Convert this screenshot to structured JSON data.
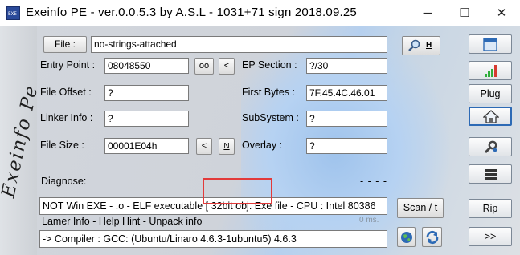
{
  "window": {
    "title": "Exeinfo PE - ver.0.0.5.3  by A.S.L  -  1031+71 sign  2018.09.25",
    "icon_label": "EXE",
    "minimize_glyph": "─",
    "maximize_glyph": "☐",
    "close_glyph": "✕"
  },
  "sidebar": {
    "brand": "Exeinfo Pe"
  },
  "file": {
    "button_label": "File :",
    "value": "no-strings-attached",
    "search_hotkey": "H"
  },
  "fields": {
    "entry_point": {
      "label": "Entry Point :",
      "value": "08048550"
    },
    "ep_section": {
      "label": "EP Section :",
      "value": "?/30"
    },
    "file_offset": {
      "label": "File Offset :",
      "value": "?"
    },
    "first_bytes": {
      "label": "First Bytes :",
      "value": "7F.45.4C.46.01"
    },
    "linker_info": {
      "label": "Linker Info :",
      "value": "?"
    },
    "subsystem": {
      "label": "SubSystem :",
      "value": "?"
    },
    "file_size": {
      "label": "File Size :",
      "value": "00001E04h"
    },
    "overlay": {
      "label": "Overlay :",
      "value": "?"
    }
  },
  "entry_buttons": {
    "oo": "oo",
    "lt": "<"
  },
  "size_buttons": {
    "lt": "<",
    "n": "N"
  },
  "diagnose": {
    "label": "Diagnose:",
    "dashes": "- - - -",
    "result": "NOT Win EXE - .o - ELF executable [ 32bit obj. Exe file - CPU : Intel 80386",
    "timing": "0 ms.",
    "lamer_info": "Lamer Info - Help Hint - Unpack info",
    "compiler": " -> Compiler : GCC: (Ubuntu/Linaro 4.6.3-1ubuntu5) 4.6.3"
  },
  "buttons": {
    "scan": "Scan / t",
    "plug": "Plug",
    "rip": "Rip",
    "next": ">>"
  },
  "colors": {
    "highlight_box": "#e23a3a",
    "selected_border": "#2d6ab5",
    "signal_green": "#2fae3a",
    "signal_red": "#d63b2f"
  }
}
